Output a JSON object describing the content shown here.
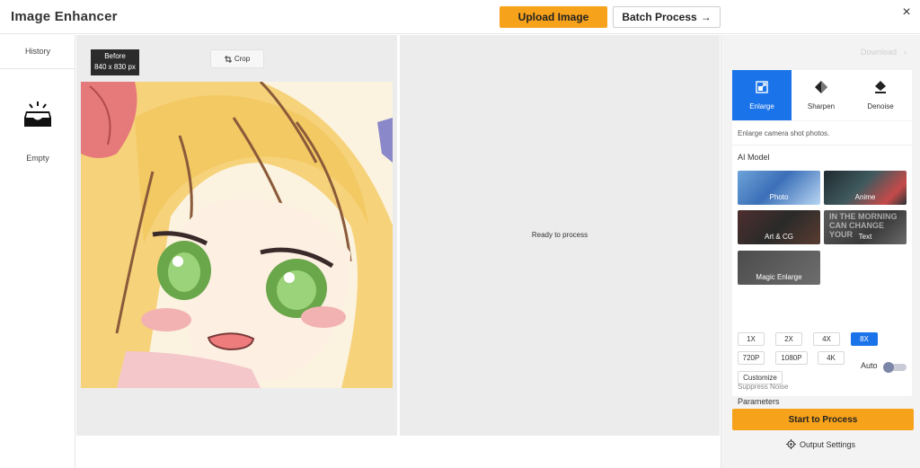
{
  "header": {
    "title": "Image Enhancer",
    "upload_label": "Upload Image",
    "batch_label": "Batch Process",
    "batch_arrow": "→",
    "close_glyph": "×"
  },
  "history": {
    "label": "History",
    "empty_label": "Empty"
  },
  "before": {
    "badge_title": "Before",
    "badge_size": "840 x 830 px",
    "crop_label": "Crop"
  },
  "after": {
    "status": "Ready to process"
  },
  "controls": {
    "download_label": "Download",
    "modes": [
      {
        "label": "Enlarge",
        "icon": "enlarge-icon",
        "active": true
      },
      {
        "label": "Sharpen",
        "icon": "sharpen-icon",
        "active": false
      },
      {
        "label": "Denoise",
        "icon": "denoise-icon",
        "active": false
      }
    ],
    "description": "Enlarge camera shot photos.",
    "ai_model_title": "AI Model",
    "models": [
      {
        "label": "Photo"
      },
      {
        "label": "Anime"
      },
      {
        "label": "Art & CG"
      },
      {
        "label": "Text",
        "watermark": "IN THE MORNING CAN CHANGE YOUR"
      },
      {
        "label": "Magic Enlarge"
      }
    ],
    "scales": [
      {
        "label": "1X",
        "active": false
      },
      {
        "label": "2X",
        "active": false
      },
      {
        "label": "4X",
        "active": false
      },
      {
        "label": "8X",
        "active": true
      },
      {
        "label": "720P",
        "active": false
      },
      {
        "label": "1080P",
        "active": false
      },
      {
        "label": "4K",
        "active": false
      },
      {
        "label": "Customize",
        "active": false
      }
    ],
    "parameters_title": "Parameters",
    "auto_label": "Auto",
    "auto_enabled": false,
    "suppress_noise_label": "Suppress Noise",
    "start_label": "Start to Process",
    "output_settings_label": "Output Settings"
  },
  "colors": {
    "accent_orange": "#f7a21b",
    "accent_blue": "#1a73e8",
    "panel_gray": "#ececec"
  }
}
